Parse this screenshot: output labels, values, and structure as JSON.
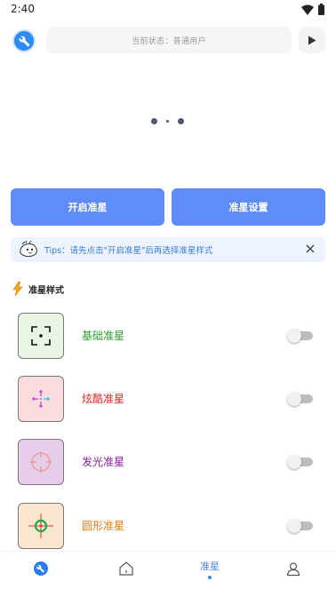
{
  "status_bar": {
    "time": "2:40"
  },
  "top_bar": {
    "status_text": "当前状态：普通用户"
  },
  "actions": {
    "start_label": "开启准星",
    "settings_label": "准星设置"
  },
  "tips": {
    "text": "Tips：请先点击\"开启准星\"后再选择准星样式"
  },
  "section": {
    "title": "准星样式"
  },
  "styles": [
    {
      "label": "基础准星",
      "color": "#2e9a2e",
      "thumb_bg": "#eaf5e4",
      "enabled": false
    },
    {
      "label": "炫酷准星",
      "color": "#e02424",
      "thumb_bg": "#fbdcdc",
      "enabled": false
    },
    {
      "label": "发光准星",
      "color": "#8a1f9e",
      "thumb_bg": "#e6cdea",
      "enabled": false
    },
    {
      "label": "圆形准星",
      "color": "#e07d12",
      "thumb_bg": "#fbe6cf",
      "enabled": false
    }
  ],
  "bottom_nav": {
    "active_tab_label": "准星",
    "accent": "#4a84f0"
  }
}
